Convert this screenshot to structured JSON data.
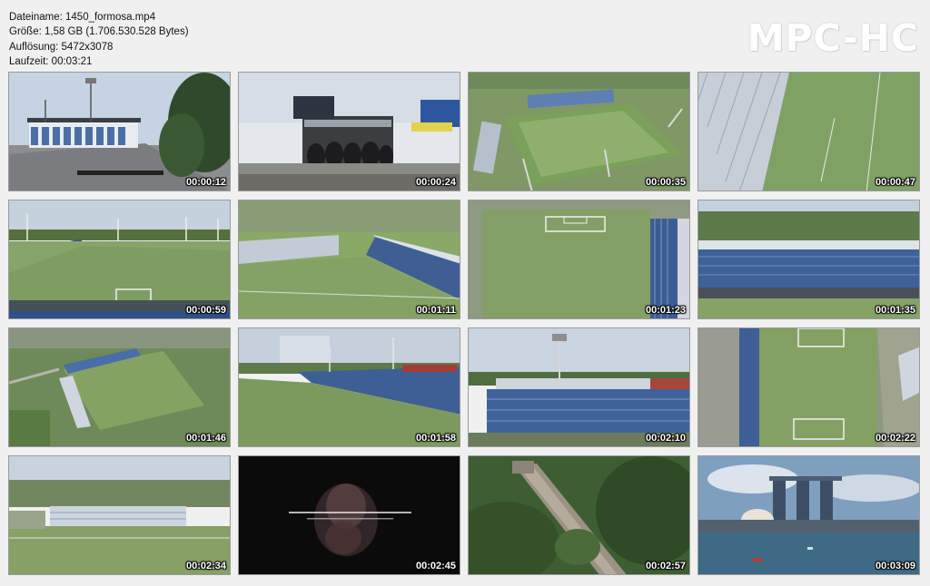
{
  "info": {
    "filename": "Dateiname: 1450_formosa.mp4",
    "size": "Größe: 1,58 GB (1.706.530.528 Bytes)",
    "resolution": "Auflösung: 5472x3078",
    "duration": "Laufzeit: 00:03:21"
  },
  "logo": "MPC-HC",
  "thumbnails": [
    {
      "time": "00:00:12",
      "scene": "stadium-exterior-street"
    },
    {
      "time": "00:00:24",
      "scene": "stadium-entrance-wall"
    },
    {
      "time": "00:00:35",
      "scene": "aerial-stadium-wide"
    },
    {
      "time": "00:00:47",
      "scene": "aerial-stand-roof"
    },
    {
      "time": "00:00:59",
      "scene": "field-goal-view"
    },
    {
      "time": "00:01:11",
      "scene": "aerial-stands-corner"
    },
    {
      "time": "00:01:23",
      "scene": "top-down-pitch"
    },
    {
      "time": "00:01:35",
      "scene": "main-stand-aerial"
    },
    {
      "time": "00:01:46",
      "scene": "aerial-pitch-town"
    },
    {
      "time": "00:01:58",
      "scene": "low-aerial-stand"
    },
    {
      "time": "00:02:10",
      "scene": "stand-front-view"
    },
    {
      "time": "00:02:22",
      "scene": "top-down-pitch-right"
    },
    {
      "time": "00:02:34",
      "scene": "distant-stadium-aerial"
    },
    {
      "time": "00:02:45",
      "scene": "title-card-dark"
    },
    {
      "time": "00:02:57",
      "scene": "great-wall-aerial"
    },
    {
      "time": "00:03:09",
      "scene": "marina-bay-skyline"
    }
  ]
}
